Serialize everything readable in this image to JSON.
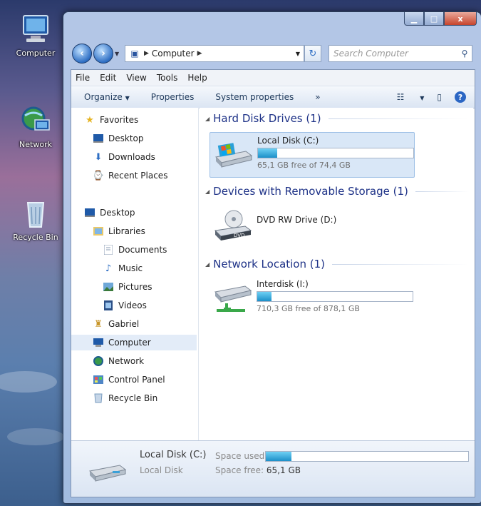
{
  "desktop": {
    "icons": [
      {
        "label": "Computer"
      },
      {
        "label": "Network"
      },
      {
        "label": "Recycle Bin"
      }
    ]
  },
  "window": {
    "caption": {
      "close": "x"
    },
    "address": {
      "crumb": "Computer"
    },
    "search": {
      "placeholder": "Search Computer"
    },
    "menu": [
      "File",
      "Edit",
      "View",
      "Tools",
      "Help"
    ],
    "toolbar": {
      "organize": "Organize",
      "properties": "Properties",
      "system_properties": "System properties",
      "more": "»"
    },
    "nav": [
      {
        "label": "Favorites",
        "icon": "star-icon"
      },
      {
        "label": "Desktop",
        "icon": "desktop-icon"
      },
      {
        "label": "Downloads",
        "icon": "downloads-icon"
      },
      {
        "label": "Recent Places",
        "icon": "recent-places-icon"
      },
      {
        "label": "Desktop",
        "icon": "desktop-icon"
      },
      {
        "label": "Libraries",
        "icon": "libraries-icon"
      },
      {
        "label": "Documents",
        "icon": "documents-icon"
      },
      {
        "label": "Music",
        "icon": "music-icon"
      },
      {
        "label": "Pictures",
        "icon": "pictures-icon"
      },
      {
        "label": "Videos",
        "icon": "videos-icon"
      },
      {
        "label": "Gabriel",
        "icon": "user-icon"
      },
      {
        "label": "Computer",
        "icon": "computer-icon",
        "selected": true
      },
      {
        "label": "Network",
        "icon": "network-icon"
      },
      {
        "label": "Control Panel",
        "icon": "control-panel-icon"
      },
      {
        "label": "Recycle Bin",
        "icon": "recycle-bin-icon"
      }
    ],
    "groups": {
      "hard_disk": "Hard Disk Drives (1)",
      "removable": "Devices with Removable Storage (1)",
      "network": "Network Location (1)"
    },
    "drives": {
      "local": {
        "name": "Local Disk (C:)",
        "free_text": "65,1 GB free of 74,4 GB",
        "used_fraction": 0.125
      },
      "dvd": {
        "name": "DVD RW Drive (D:)",
        "badge": "DVD"
      },
      "interdisk": {
        "name": "Interdisk (I:)",
        "free_text": "710,3 GB free of 878,1 GB",
        "used_fraction": 0.09
      }
    },
    "details": {
      "name": "Local Disk (C:)",
      "type": "Local Disk",
      "space_used_label": "Space used:",
      "space_free_label": "Space free:",
      "space_free_value": "65,1 GB",
      "used_fraction": 0.125
    }
  }
}
